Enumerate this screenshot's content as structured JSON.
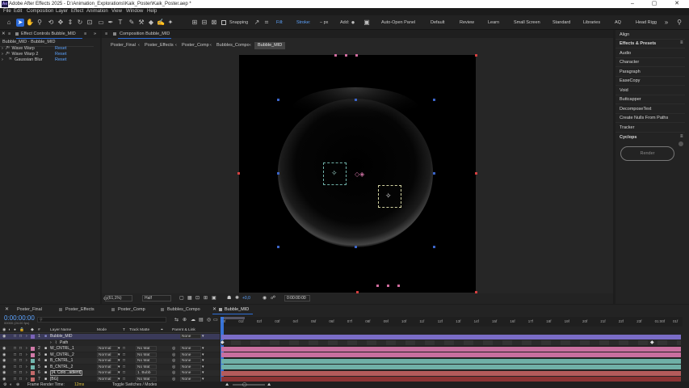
{
  "window": {
    "title": "Adobe After Effects 2025 - D:\\Animation_Explorations\\Kaik_Poster\\Kaik_Poster.aep *",
    "logo": "Ae",
    "minimize": "–",
    "maximize": "▢",
    "close": "✕"
  },
  "menu": [
    "File",
    "Edit",
    "Composition",
    "Layer",
    "Effect",
    "Animation",
    "View",
    "Window",
    "Help"
  ],
  "toolbar": {
    "snapping": "Snapping",
    "fill": "Fill:",
    "stroke": "Stroke:",
    "stroke_unit": "– px",
    "add": "Add:",
    "auto_open": "Auto-Open Panel",
    "fill_color": "#e0161c"
  },
  "workspaces": [
    "Default",
    "Review",
    "Learn",
    "Small Screen",
    "Standard",
    "Libraries",
    "AQ",
    "Head Rigg"
  ],
  "effect_controls": {
    "tab": "Effect Controls Bubble_MID",
    "subtitle": "Bubble_MID · Bubble_MID",
    "effects": [
      {
        "name": "Wave Warp",
        "reset": "Reset"
      },
      {
        "name": "Wave Warp 2",
        "reset": "Reset"
      },
      {
        "name": "Gaussian Blur",
        "reset": "Reset"
      }
    ]
  },
  "composition": {
    "tab": "Composition Bubble_MID",
    "breadcrumbs": [
      "Poster_Final",
      "Poster_Effects",
      "Poster_Comp",
      "Bubbles_Compo",
      "Bubble_MID"
    ],
    "zoom": "(61,1%)",
    "resolution": "Half",
    "exposure": "+0,0",
    "timecode": "0:00:00:00"
  },
  "right_panel": {
    "items": [
      "Align",
      "Effects & Presets",
      "Audio",
      "Character",
      "Paragraph",
      "EaseCopy",
      "Void",
      "Buttcapper",
      "DecomposeText",
      "Create Nulls From Paths",
      "Tracker",
      "Cyclops"
    ],
    "render": "Render"
  },
  "timeline": {
    "tabs": [
      "Poster_Final",
      "Poster_Effects",
      "Poster_Comp",
      "Bubbles_Compo",
      "Bubble_MID"
    ],
    "timecode": "0:00:00:00",
    "fps": "00000 (24.00 fps)",
    "col_headers": {
      "layer_name": "Layer Name",
      "mode": "Mode",
      "t": "T",
      "track_matte": "Track Matte",
      "parent": "Parent & Link"
    },
    "ticks": [
      "00f",
      "01f",
      "02f",
      "03f",
      "04f",
      "05f",
      "06f",
      "07f",
      "08f",
      "09f",
      "10f",
      "11f",
      "12f",
      "13f",
      "14f",
      "15f",
      "16f",
      "17f",
      "18f",
      "19f",
      "20f",
      "21f",
      "22f",
      "23f",
      "01:00f",
      "01f"
    ],
    "layers": [
      {
        "num": "1",
        "name": "Bubble_MID",
        "mode": "",
        "matte": "",
        "parent": "None",
        "color": "#7b62b8",
        "bar": "#7a6dc7"
      },
      {
        "num": "",
        "name": "Path",
        "mode": "",
        "matte": "",
        "parent": "",
        "color": "#3a3a3a",
        "bar": "#2a2a2a"
      },
      {
        "num": "2",
        "name": "W_CNTRL_1",
        "mode": "Normal",
        "matte": "No Mat",
        "parent": "None",
        "color": "#d07aa8",
        "bar": "#c96f9f"
      },
      {
        "num": "3",
        "name": "W_CNTRL_2",
        "mode": "Normal",
        "matte": "No Mat",
        "parent": "None",
        "color": "#d07aa8",
        "bar": "#c96f9f"
      },
      {
        "num": "4",
        "name": "B_CNTRL_1",
        "mode": "Normal",
        "matte": "No Mat",
        "parent": "None",
        "color": "#72b7ae",
        "bar": "#6fb0a7"
      },
      {
        "num": "5",
        "name": "B_CNTRL_2",
        "mode": "Normal",
        "matte": "No Mat",
        "parent": "None",
        "color": "#72b7ae",
        "bar": "#6fb0a7"
      },
      {
        "num": "6",
        "name": "[4. Colo...adient]",
        "mode": "Normal",
        "matte": "1. Bubb",
        "parent": "None",
        "color": "#c26a6a",
        "bar": "#b45b5b"
      },
      {
        "num": "7",
        "name": "[BG]",
        "mode": "Normal",
        "matte": "No Mat",
        "parent": "None",
        "color": "#c26a6a",
        "bar": "#8b3434"
      }
    ],
    "footer_left": "Frame Render Time:",
    "footer_ms": "12ms",
    "footer_mid": "Toggle Switches / Modes"
  }
}
